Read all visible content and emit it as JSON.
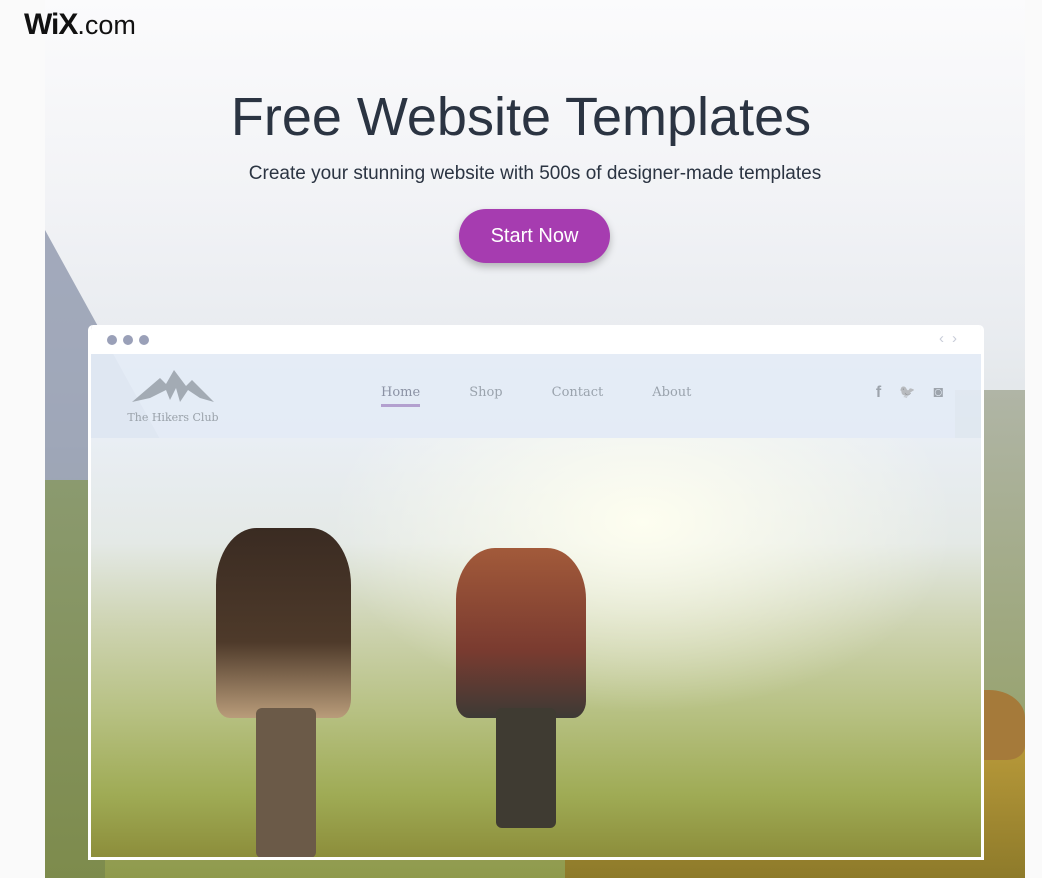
{
  "brand": {
    "logo_main": "WiX",
    "logo_suffix": ".com"
  },
  "hero": {
    "title": "Free Website Templates",
    "subtitle": "Create your stunning website with 500s of designer-made templates",
    "cta_label": "Start Now",
    "cta_color": "#a63cb0"
  },
  "preview": {
    "site_name": "The Hikers Club",
    "nav": [
      {
        "label": "Home",
        "active": true
      },
      {
        "label": "Shop"
      },
      {
        "label": "Contact"
      },
      {
        "label": "About"
      }
    ],
    "social": [
      "facebook-icon",
      "twitter-icon",
      "instagram-icon"
    ],
    "social_glyphs": {
      "facebook": "f",
      "twitter": "🐦",
      "instagram": "◙"
    },
    "arrows": {
      "prev": "‹",
      "next": "›"
    }
  }
}
